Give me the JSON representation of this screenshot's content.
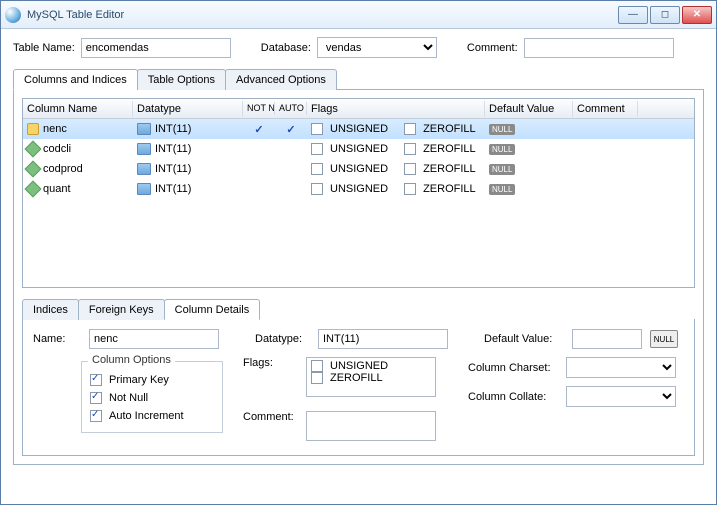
{
  "window": {
    "title": "MySQL Table Editor"
  },
  "top": {
    "tableNameLabel": "Table Name:",
    "tableName": "encomendas",
    "databaseLabel": "Database:",
    "database": "vendas",
    "commentLabel": "Comment:",
    "comment": ""
  },
  "tabs": {
    "main": [
      "Columns and Indices",
      "Table Options",
      "Advanced Options"
    ],
    "mainActive": 0,
    "sub": [
      "Indices",
      "Foreign Keys",
      "Column Details"
    ],
    "subActive": 2
  },
  "grid": {
    "headers": {
      "colName": "Column Name",
      "datatype": "Datatype",
      "notNull": "NOT NULL",
      "autoInc": "AUTO INC",
      "flags": "Flags",
      "default": "Default Value",
      "comment": "Comment"
    },
    "flagLabels": {
      "unsigned": "UNSIGNED",
      "zerofill": "ZEROFILL"
    },
    "nullText": "NULL",
    "rows": [
      {
        "name": "nenc",
        "datatype": "INT(11)",
        "pk": true,
        "notNull": true,
        "autoInc": true,
        "unsigned": false,
        "zerofill": false,
        "defaultNull": true,
        "selected": true
      },
      {
        "name": "codcli",
        "datatype": "INT(11)",
        "pk": false,
        "notNull": false,
        "autoInc": false,
        "unsigned": false,
        "zerofill": false,
        "defaultNull": true
      },
      {
        "name": "codprod",
        "datatype": "INT(11)",
        "pk": false,
        "notNull": false,
        "autoInc": false,
        "unsigned": false,
        "zerofill": false,
        "defaultNull": true
      },
      {
        "name": "quant",
        "datatype": "INT(11)",
        "pk": false,
        "notNull": false,
        "autoInc": false,
        "unsigned": false,
        "zerofill": false,
        "defaultNull": true
      }
    ]
  },
  "details": {
    "nameLabel": "Name:",
    "name": "nenc",
    "datatypeLabel": "Datatype:",
    "datatype": "INT(11)",
    "defaultLabel": "Default Value:",
    "defaultValue": "",
    "optionsLegend": "Column Options",
    "opts": {
      "pkLabel": "Primary Key",
      "pk": true,
      "nnLabel": "Not Null",
      "nn": true,
      "aiLabel": "Auto Increment",
      "ai": true
    },
    "flagsLabel": "Flags:",
    "flags": {
      "unsignedLabel": "UNSIGNED",
      "unsigned": false,
      "zerofillLabel": "ZEROFILL",
      "zerofill": false
    },
    "charsetLabel": "Column Charset:",
    "collateLabel": "Column Collate:",
    "commentLabel": "Comment:",
    "comment": "",
    "nullBtn": "NULL"
  }
}
